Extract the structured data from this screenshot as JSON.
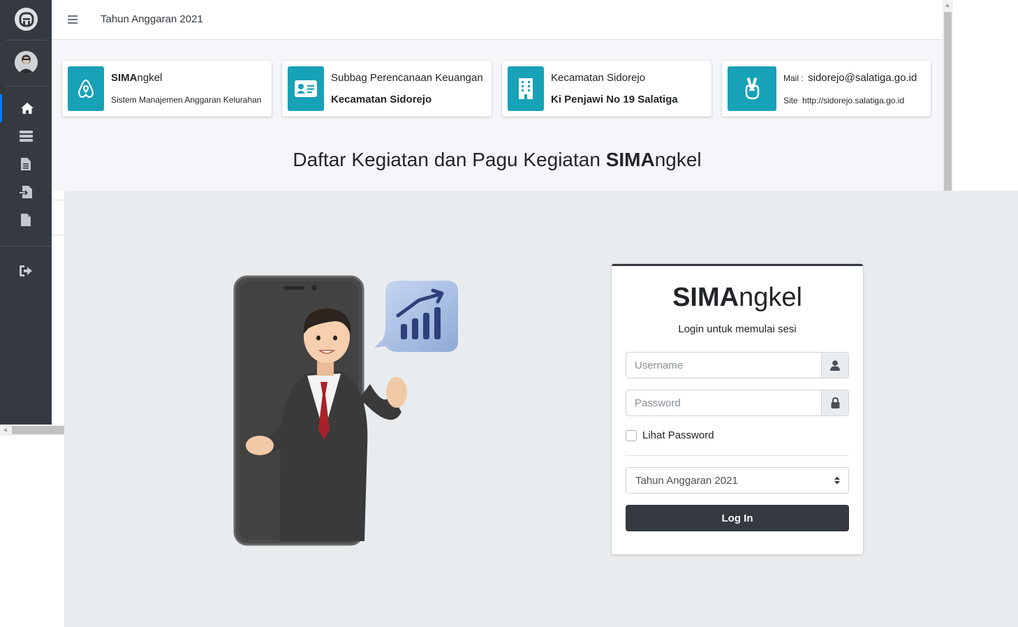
{
  "navbar": {
    "year_title": "Tahun Anggaran 2021"
  },
  "info_boxes": [
    {
      "line1_bold": "SIMA",
      "line1_rest": "ngkel",
      "line2": "Sistem Manajemen Anggaran Kelurahan",
      "icon": "airbnb-icon"
    },
    {
      "line1": "Subbag Perencanaan Keuangan",
      "line2": "Kecamatan Sidorejo",
      "icon": "id-card-icon"
    },
    {
      "line1": "Kecamatan Sidorejo",
      "line2": "Ki Penjawi No 19 Salatiga",
      "icon": "building-icon"
    },
    {
      "mail_label": "Mail :",
      "mail_value": "sidorejo@salatiga.go.id",
      "site_label": "Site",
      "site_value": "http://sidorejo.salatiga.go.id",
      "icon": "peace-hand-icon"
    }
  ],
  "heading": {
    "prefix": "Daftar Kegiatan dan Pagu Kegiatan ",
    "bold": "SIMA",
    "suffix": "ngkel"
  },
  "login": {
    "brand_bold": "SIMA",
    "brand_rest": "ngkel",
    "message": "Login untuk memulai sesi",
    "username_placeholder": "Username",
    "password_placeholder": "Password",
    "show_password_label": "Lihat Password",
    "year_selected": "Tahun Anggaran 2021",
    "submit_label": "Log In"
  },
  "colors": {
    "sidebar": "#343a40",
    "accent": "#17a2b8",
    "active": "#007bff",
    "overlay": "#e9ecef"
  }
}
